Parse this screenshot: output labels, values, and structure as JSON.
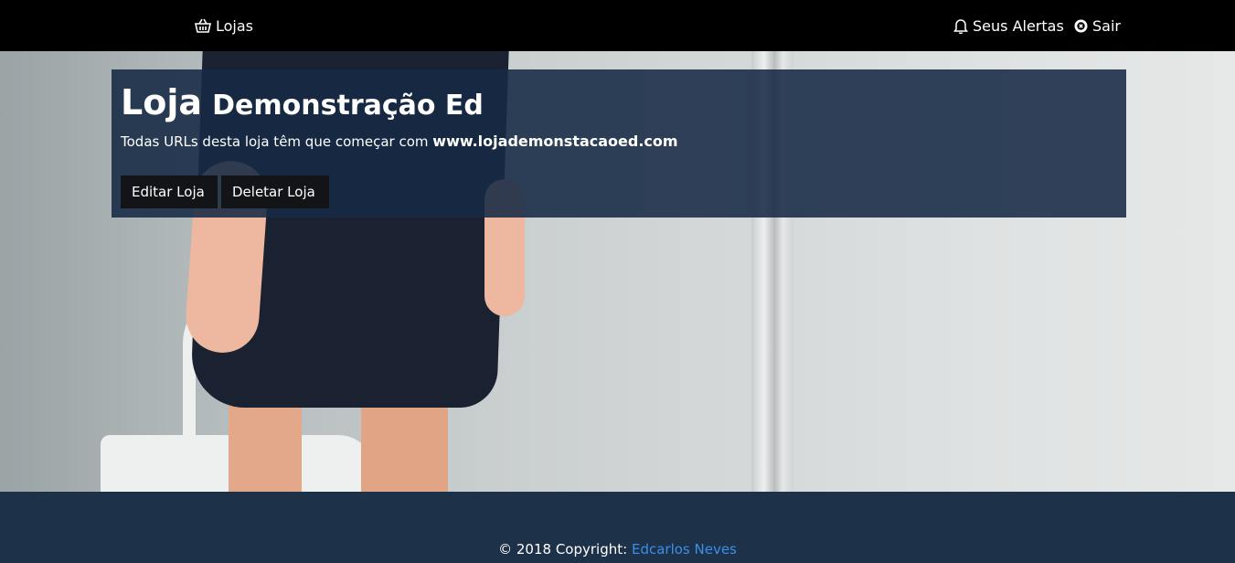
{
  "nav": {
    "lojas": {
      "label": "Lojas",
      "icon": "basket-icon"
    },
    "alertas": {
      "label": "Seus Alertas",
      "icon": "bell-icon"
    },
    "sair": {
      "label": "Sair",
      "icon": "close-circle-icon"
    }
  },
  "store": {
    "title_prefix": "Loja",
    "title_name": "Demonstração Ed",
    "url_text": "Todas URLs desta loja têm que começar com",
    "url_value": "www.lojademonstacaoed.com",
    "edit_label": "Editar Loja",
    "delete_label": "Deletar Loja"
  },
  "footer": {
    "copyright": "© 2018 Copyright:",
    "author": "Edcarlos Neves"
  },
  "colors": {
    "nav_bg": "#000000",
    "panel_bg": "#162944",
    "footer_bg": "#1d3149",
    "link": "#3b8fe8"
  }
}
